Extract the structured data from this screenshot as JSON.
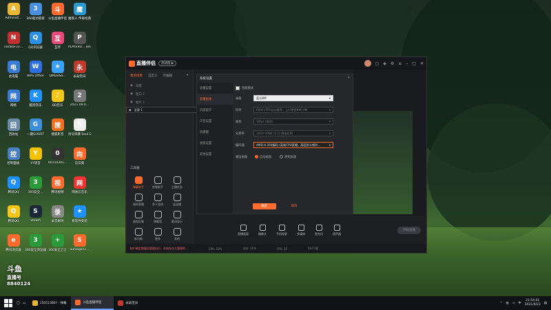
{
  "desktop_icons": [
    {
      "label": "Administ...",
      "color": "#e8b632",
      "glyph": "A"
    },
    {
      "label": "360驱动管家",
      "color": "#4a8ee0",
      "glyph": "3"
    },
    {
      "label": "斗鱼直播伴侣",
      "color": "#ff6a2e",
      "glyph": "斗"
    },
    {
      "label": "魔兽人 传奇经典",
      "color": "#2a9ad0",
      "glyph": "魔"
    },
    {
      "label": "naraka-v3...",
      "color": "#c03030",
      "glyph": "N"
    },
    {
      "label": "QQ浏览器",
      "color": "#2a8fe0",
      "glyph": "Q"
    },
    {
      "label": "互传",
      "color": "#e64a7a",
      "glyph": "互"
    },
    {
      "label": "PLAYERU... BATTLEGR...",
      "color": "#555",
      "glyph": "P"
    },
    {
      "label": "此电脑",
      "color": "#3a7bd5",
      "glyph": "电"
    },
    {
      "label": "WPS Office",
      "color": "#2f6fe0",
      "glyph": "W"
    },
    {
      "label": "QMiaoSa...",
      "color": "#3aa0ff",
      "glyph": "★"
    },
    {
      "label": "永劫无间",
      "color": "#c0392b",
      "glyph": "永"
    },
    {
      "label": "网络",
      "color": "#3a7bd5",
      "glyph": "网"
    },
    {
      "label": "酷狗音乐",
      "color": "#1e90ff",
      "glyph": "K"
    },
    {
      "label": "QQ音乐",
      "color": "#f5c518",
      "glyph": "♪"
    },
    {
      "label": "2021.09.0...",
      "color": "#777",
      "glyph": "2"
    },
    {
      "label": "回收站",
      "color": "#6a8aa8",
      "glyph": "回"
    },
    {
      "label": "一键GHOST",
      "color": "#3b8fd8",
      "glyph": "G"
    },
    {
      "label": "搜狐影音",
      "color": "#f07020",
      "glyph": "搜"
    },
    {
      "label": "封号风暴 Soul D...",
      "color": "#eee",
      "glyph": "S"
    },
    {
      "label": "控制面板",
      "color": "#4a7fc0",
      "glyph": "控"
    },
    {
      "label": "YY语音",
      "color": "#f2c200",
      "glyph": "Y"
    },
    {
      "label": "00110341...",
      "color": "#333",
      "glyph": "0"
    },
    {
      "label": "向日葵",
      "color": "#ff6a2e",
      "glyph": "向"
    },
    {
      "label": "腾讯QQ",
      "color": "#1e90ff",
      "glyph": "Q"
    },
    {
      "label": "360安全...",
      "color": "#2a9a3a",
      "glyph": "3"
    },
    {
      "label": "腾讯视频",
      "color": "#ff6a2e",
      "glyph": "视"
    },
    {
      "label": "网易云音乐",
      "color": "#e33",
      "glyph": "网"
    },
    {
      "label": "腾讯QQ",
      "color": "#f5c518",
      "glyph": "Q"
    },
    {
      "label": "Steam",
      "color": "#1b2838",
      "glyph": "S"
    },
    {
      "label": "录音剧场",
      "color": "#888",
      "glyph": "录"
    },
    {
      "label": "新软件安装",
      "color": "#1e90ff",
      "glyph": "★"
    },
    {
      "label": "腾讯浏览器",
      "color": "#ff6a2e",
      "glyph": "e"
    },
    {
      "label": "360安全浏览器",
      "color": "#2a9a3a",
      "glyph": "3"
    },
    {
      "label": "360安全卫士",
      "color": "#2a9a3a",
      "glyph": "+"
    },
    {
      "label": "SunloginCl...",
      "color": "#ff6a2e",
      "glyph": "S"
    }
  ],
  "app": {
    "name": "直播伴侣",
    "version": "测试版 ▶",
    "tabs": [
      "我的场景",
      "自定义",
      "可编辑"
    ],
    "add_icon": "+",
    "scenes": [
      {
        "label": "场景",
        "selected": false
      },
      {
        "label": "窗口 1",
        "selected": false
      },
      {
        "label": "图片 1",
        "selected": false
      },
      {
        "label": "全屏 1",
        "selected": true
      }
    ],
    "tools_title": "工具箱",
    "tools": [
      {
        "label": "弹幕助手",
        "hot": true
      },
      {
        "label": "房管助手",
        "hot": false
      },
      {
        "label": "主播任务",
        "hot": false
      },
      {
        "label": "福利直播",
        "hot": false
      },
      {
        "label": "多人连线",
        "hot": false
      },
      {
        "label": "连连播",
        "hot": false
      },
      {
        "label": "虚拟形象",
        "hot": false
      },
      {
        "label": "弹幕墙",
        "hot": false
      },
      {
        "label": "歌词显示",
        "hot": false
      },
      {
        "label": "新功能",
        "hot": false
      },
      {
        "label": "更多",
        "hot": false
      },
      {
        "label": "其他",
        "hot": false
      }
    ],
    "settings": {
      "title": "系统设置",
      "close": "✕",
      "nav": [
        "直播设置",
        "直播画质",
        "内容提示",
        "声音设置",
        "快捷键",
        "视频设置",
        "其他设置"
      ],
      "nav_active": 1,
      "smart_mode_label": "智能模式",
      "rows": [
        {
          "label": "画质",
          "value": "蓝光8M",
          "style": "white"
        },
        {
          "label": "码率",
          "value": "6000 (FPS自动推荐，上行带宽8M) 8M",
          "style": "dark"
        },
        {
          "label": "帧率",
          "value": "30fps (推荐)",
          "style": "dark"
        },
        {
          "label": "分辨率",
          "value": "1920*1080 (1:1) 原始比例",
          "style": "dark"
        },
        {
          "label": "编码器",
          "value": "AMD H.264编码 (高效CPU直播，高画质卡顿时…",
          "style": "hi"
        }
      ],
      "output_label": "输出画面",
      "output_options": [
        "自动画面",
        "原始画面"
      ],
      "ok": "确定",
      "cancel": "取消"
    },
    "bottom_buttons": [
      "直播画面",
      "摄像头",
      "手机投屏",
      "多媒体",
      "麦克风",
      "扬声器"
    ],
    "start_live": "开始直播",
    "status": {
      "warning": "帐户确定数量总管理自行、系统存在大管理的...",
      "cpu": "CPU: 10%",
      "mem": "内存: 31%",
      "fps": "FPS: 30",
      "net": "4G/下载"
    }
  },
  "watermark": {
    "line1": "斗鱼",
    "line2": "直播号",
    "id": "8840124"
  },
  "taskbar": {
    "items": [
      {
        "label": "15051386? - 弹幕...",
        "color": "#e8b632",
        "active": false
      },
      {
        "label": "斗鱼直播伴侣",
        "color": "#ff6a2e",
        "active": true
      },
      {
        "label": "永劫无间",
        "color": "#c0392b",
        "active": false
      }
    ],
    "time": "21:54:01",
    "date": "2021/9/23"
  }
}
